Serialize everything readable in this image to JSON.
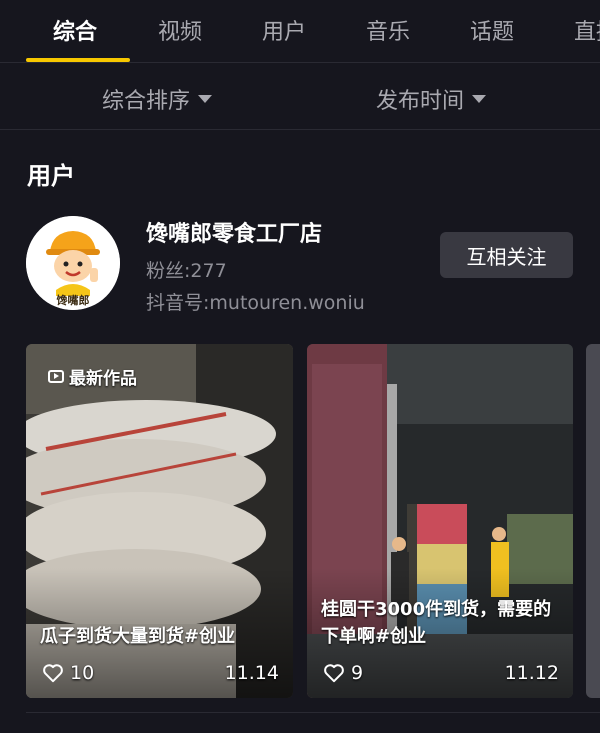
{
  "tabs": [
    "综合",
    "视频",
    "用户",
    "音乐",
    "话题",
    "直播"
  ],
  "sort": {
    "order_label": "综合排序",
    "time_label": "发布时间"
  },
  "section": {
    "title": "用户"
  },
  "user": {
    "name": "馋嘴郎零食工厂店",
    "fans": "粉丝:277",
    "douyin_id": "抖音号:mutouren.woniu",
    "follow_label": "互相关注",
    "avatar_text": "馋嘴郎"
  },
  "videos": [
    {
      "badge": "最新作品",
      "caption": "瓜子到货大量到货#创业",
      "likes": "10",
      "date": "11.14"
    },
    {
      "badge": "",
      "caption": "桂圆干3000件到货，需要的下单啊#创业",
      "likes": "9",
      "date": "11.12"
    }
  ],
  "colors": {
    "accent": "#f7c800",
    "background": "#16161e",
    "button": "#393941"
  }
}
